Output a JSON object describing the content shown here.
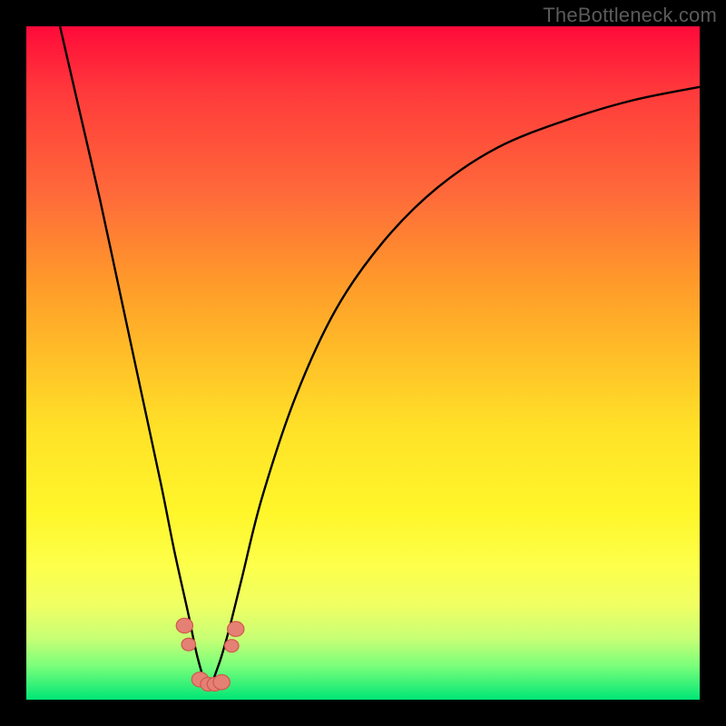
{
  "watermark": "TheBottleneck.com",
  "colors": {
    "gradient_top": "#ff0a3a",
    "gradient_bottom": "#00e676",
    "curve": "#000000",
    "marker_fill": "#e58075",
    "marker_stroke": "#d0594a",
    "frame": "#000000"
  },
  "chart_data": {
    "type": "line",
    "title": "",
    "xlabel": "",
    "ylabel": "",
    "xlim": [
      0,
      100
    ],
    "ylim": [
      0,
      100
    ],
    "grid": false,
    "note": "Axes are unlabeled; values are estimated on a 0–100 normalized scale from pixel positions. y represents the curve height (0 at bottom/green, 100 at top/red). The curve forms a V with minimum near x≈27.",
    "series": [
      {
        "name": "curve",
        "x": [
          5,
          8,
          11,
          14,
          17,
          20,
          22,
          24,
          25.5,
          27,
          28.5,
          30,
          32,
          35,
          40,
          46,
          53,
          61,
          70,
          80,
          90,
          100
        ],
        "y": [
          100,
          87,
          74,
          60,
          46,
          32,
          22,
          13,
          6,
          2,
          5,
          10,
          18,
          30,
          45,
          58,
          68,
          76,
          82,
          86,
          89,
          91
        ]
      }
    ],
    "markers": {
      "name": "highlighted-points",
      "note": "Pink bead-like markers clustered near the curve minimum.",
      "points": [
        {
          "x": 23.5,
          "y": 11,
          "r": 1.3
        },
        {
          "x": 24.1,
          "y": 8.2,
          "r": 1.1
        },
        {
          "x": 25.8,
          "y": 3.0,
          "r": 1.3
        },
        {
          "x": 27.0,
          "y": 2.3,
          "r": 1.2
        },
        {
          "x": 28.0,
          "y": 2.3,
          "r": 1.2
        },
        {
          "x": 29.0,
          "y": 2.6,
          "r": 1.3
        },
        {
          "x": 30.5,
          "y": 8.0,
          "r": 1.1
        },
        {
          "x": 31.1,
          "y": 10.5,
          "r": 1.3
        }
      ]
    }
  }
}
